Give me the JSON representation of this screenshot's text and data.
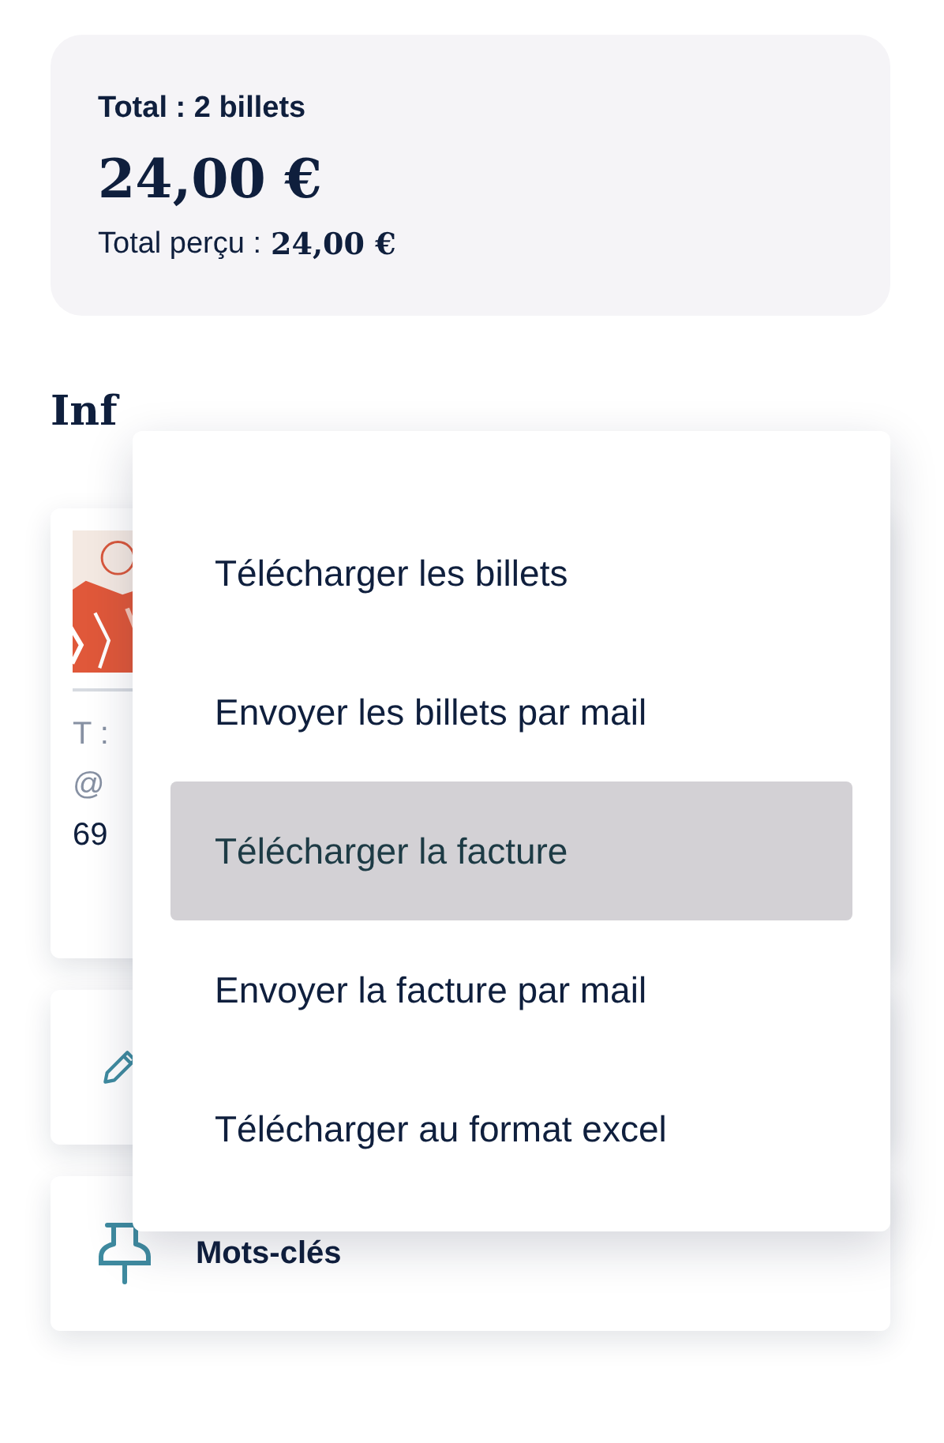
{
  "summary": {
    "title": "Total : 2 billets",
    "amount": "24,00 €",
    "received_label": "Total perçu :",
    "received_amount": "24,00 €"
  },
  "info_heading": "Inf",
  "contact": {
    "phone_label": "T :",
    "email_label": "@",
    "address": "69"
  },
  "keywords_card": {
    "label": "Mots-clés"
  },
  "menu": [
    {
      "label": "Télécharger les billets",
      "selected": false
    },
    {
      "label": "Envoyer les billets par mail",
      "selected": false
    },
    {
      "label": "Télécharger la facture",
      "selected": true
    },
    {
      "label": "Envoyer la facture par mail",
      "selected": false
    },
    {
      "label": "Télécharger au format excel",
      "selected": false
    }
  ]
}
